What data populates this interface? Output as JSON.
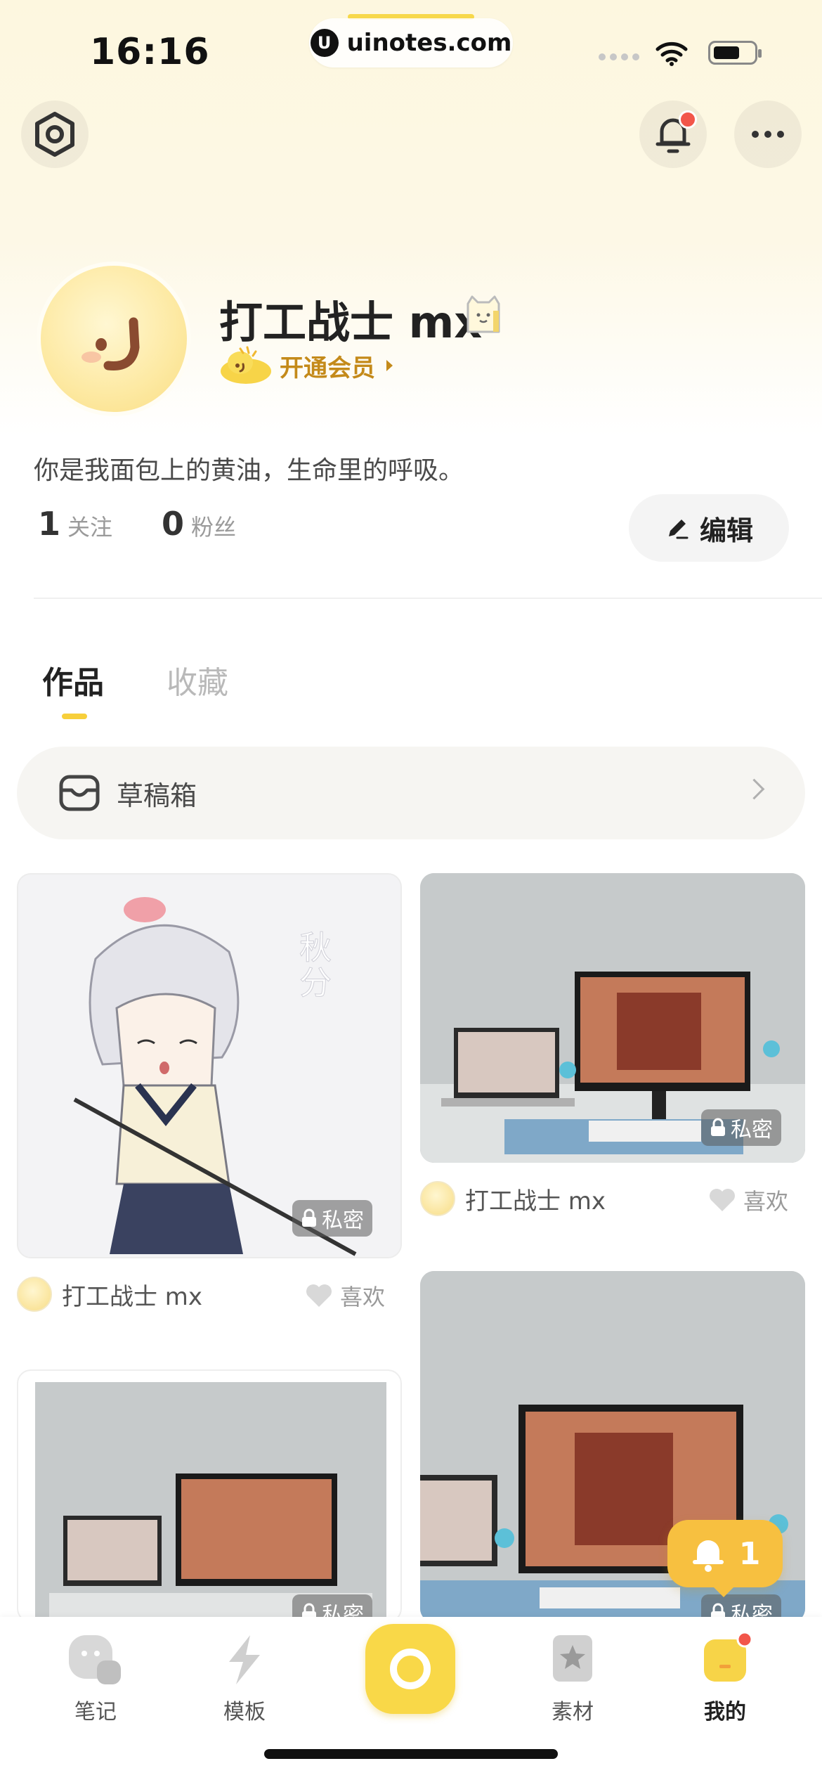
{
  "status_bar": {
    "time": "16:16",
    "url": "uinotes.com",
    "url_icon": "U"
  },
  "header": {
    "settings_icon": "settings-hex-icon",
    "bell_icon": "bell-icon",
    "more_icon": "more-dots-icon"
  },
  "profile": {
    "username": "打工战士 mx",
    "vip_label": "开通会员",
    "bio": "你是我面包上的黄油，生命里的呼吸。",
    "following_count": "1",
    "following_label": "关注",
    "followers_count": "0",
    "followers_label": "粉丝",
    "edit_label": "编辑"
  },
  "tabs": [
    {
      "label": "作品",
      "active": true
    },
    {
      "label": "收藏",
      "active": false
    }
  ],
  "drafts": {
    "label": "草稿箱"
  },
  "cards": [
    {
      "private_label": "私密",
      "author": "打工战士 mx",
      "like_label": "喜欢"
    },
    {
      "private_label": "私密",
      "author": "打工战士 mx",
      "like_label": "喜欢"
    },
    {
      "private_label": "私密"
    },
    {
      "private_label": "私密"
    }
  ],
  "floating_notification": {
    "count": "1"
  },
  "tabbar": [
    {
      "label": "笔记"
    },
    {
      "label": "模板"
    },
    {
      "label": "素材"
    },
    {
      "label": "我的",
      "active": true
    }
  ],
  "colors": {
    "accent_yellow": "#f9d848",
    "vip_gold": "#c48a1a",
    "notify_red": "#f2564a"
  }
}
